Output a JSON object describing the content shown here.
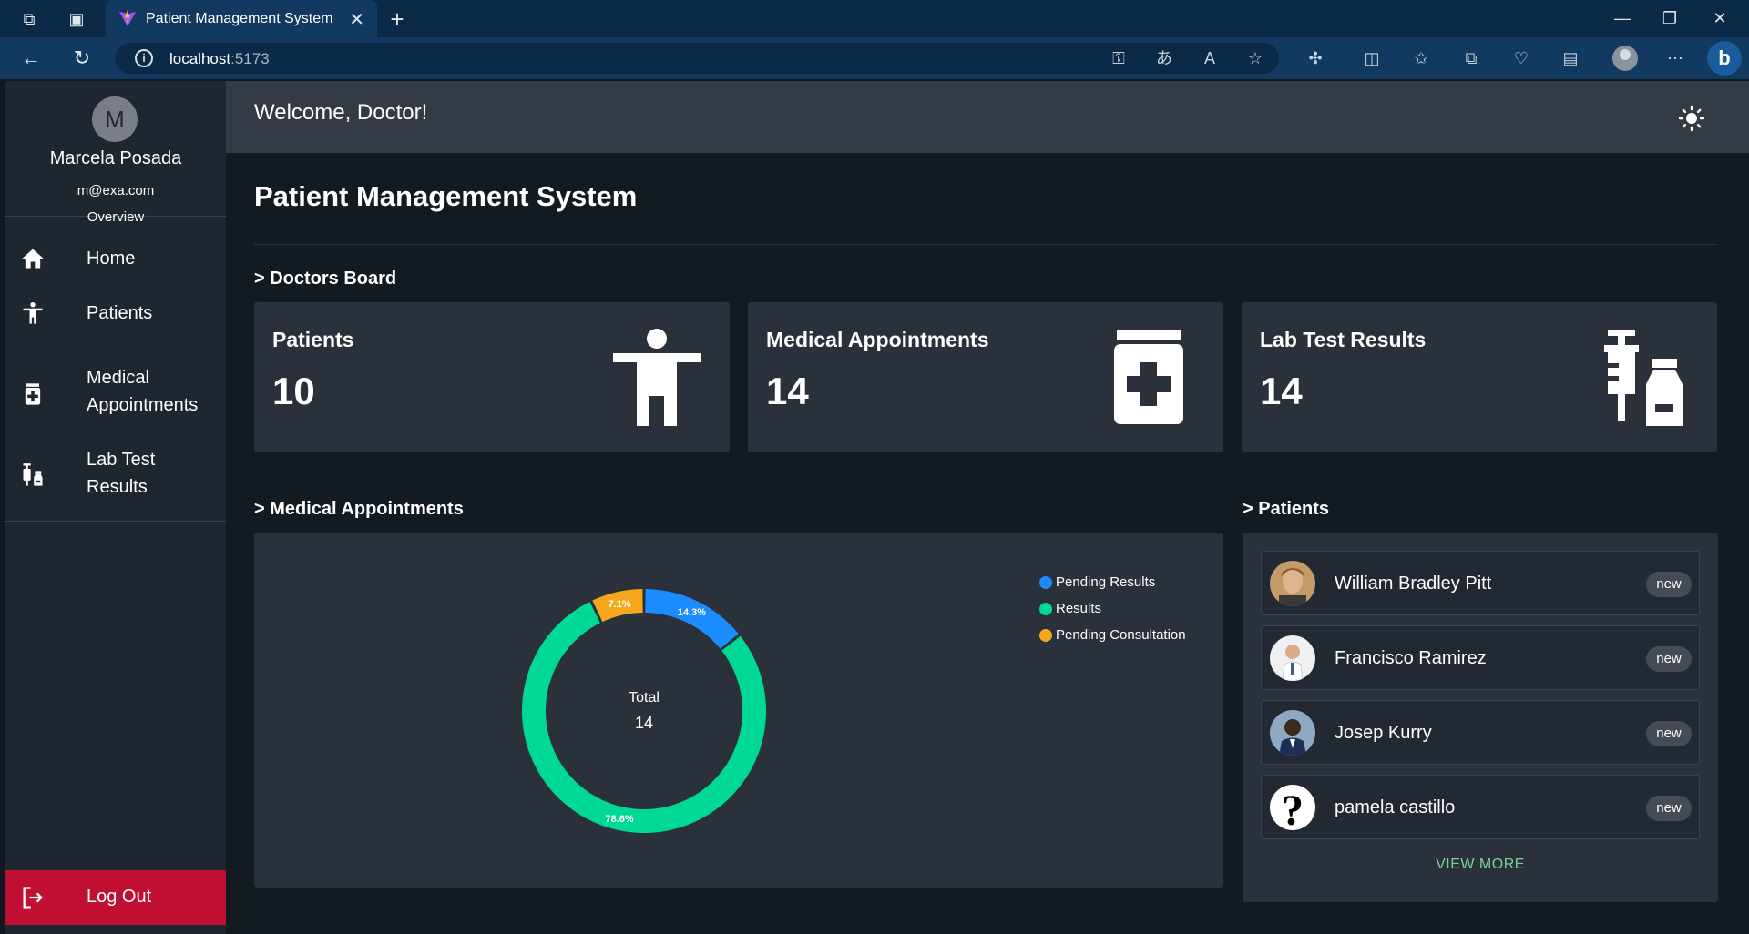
{
  "browser": {
    "tab_title": "Patient Management System",
    "url_host": "localhost",
    "url_port": ":5173"
  },
  "user": {
    "initial": "M",
    "name": "Marcela Posada",
    "email": "m@exa.com"
  },
  "sidebar": {
    "section": "Overview",
    "items": [
      {
        "label": "Home",
        "icon": "home-icon"
      },
      {
        "label": "Patients",
        "icon": "person-icon"
      },
      {
        "label": "Medical Appointments",
        "icon": "medicine-bottle-icon"
      },
      {
        "label": "Lab Test Results",
        "icon": "syringe-vial-icon"
      }
    ],
    "logout": "Log Out"
  },
  "header": {
    "welcome": "Welcome, Doctor!"
  },
  "main": {
    "title": "Patient Management System",
    "doctors_board": "> Doctors Board",
    "cards": [
      {
        "label": "Patients",
        "value": "10",
        "icon": "person-icon"
      },
      {
        "label": "Medical Appointments",
        "value": "14",
        "icon": "medicine-bottle-icon"
      },
      {
        "label": "Lab Test Results",
        "value": "14",
        "icon": "syringe-vial-icon"
      }
    ],
    "appointments_section": "> Medical Appointments",
    "patients_section": "> Patients",
    "donut_center_label": "Total",
    "donut_center_value": "14",
    "patients": [
      {
        "name": "William Bradley Pitt",
        "badge": "new"
      },
      {
        "name": "Francisco Ramirez",
        "badge": "new"
      },
      {
        "name": "Josep Kurry",
        "badge": "new"
      },
      {
        "name": "pamela castillo",
        "badge": "new"
      }
    ],
    "view_more": "VIEW MORE"
  },
  "chart_data": {
    "type": "pie",
    "categories": [
      "Pending Results",
      "Results",
      "Pending Consultation"
    ],
    "values": [
      2,
      11,
      1
    ],
    "labels": [
      "14.3%",
      "78.6%",
      "7.1%"
    ],
    "colors": [
      "#1a8cff",
      "#00d995",
      "#f6a81d"
    ],
    "legend": "top-right"
  }
}
